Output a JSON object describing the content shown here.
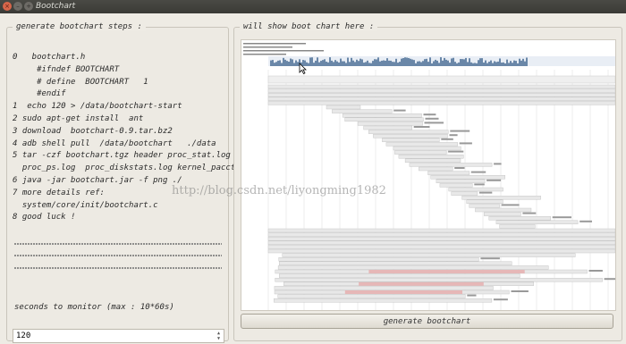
{
  "window": {
    "title": "Bootchart"
  },
  "left_panel": {
    "legend": "generate bootchart steps :",
    "steps": [
      "0   bootchart.h",
      "     #ifndef BOOTCHART",
      "     # define  BOOTCHART   1",
      "     #endif",
      "1  echo 120 > /data/bootchart-start",
      "2 sudo apt-get install  ant",
      "3 download  bootchart-0.9.tar.bz2",
      "4 adb shell pull  /data/bootchart   ./data",
      "5 tar -czf bootchart.tgz header proc_stat.log",
      "  proc_ps.log  proc_diskstats.log kernel_pacct",
      "6 java -jar bootchart.jar -f png ./",
      "7 more details ref:",
      "  system/core/init/bootchart.c",
      "8 good luck !"
    ],
    "seconds_label": "seconds to monitor (max : 10*60s)",
    "seconds_value": "120"
  },
  "right_panel": {
    "legend": "will show boot chart here :",
    "generate_button": "generate bootchart"
  },
  "watermark": "http://blog.csdn.net/liyongming1982",
  "colors": {
    "titlebar": "#3e3e3a",
    "chart_bar": "#6a87a8",
    "panel_bg": "#edeae3"
  }
}
